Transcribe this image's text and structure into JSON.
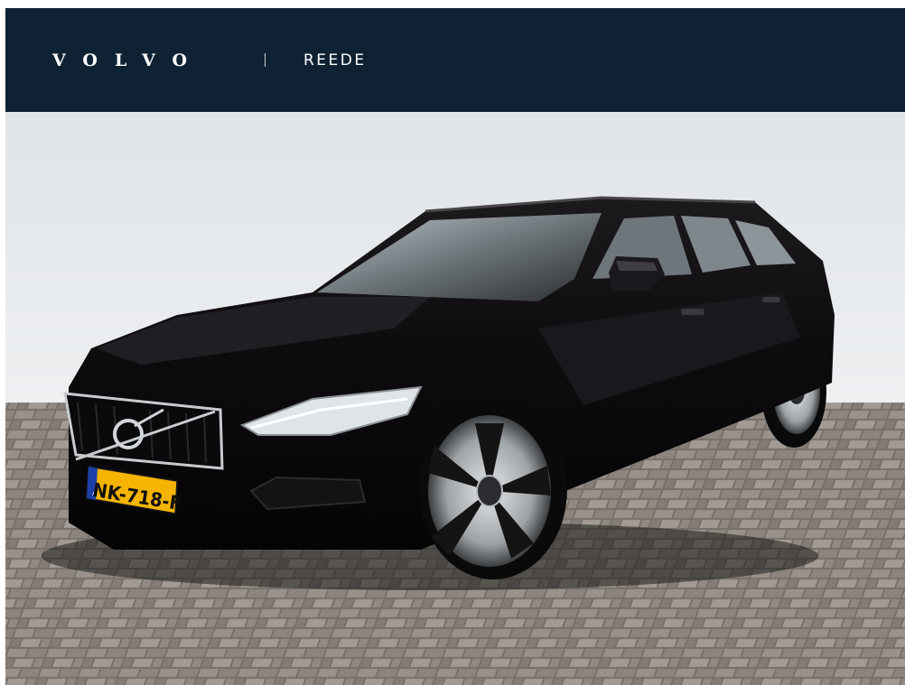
{
  "header": {
    "brand": "VOLVO",
    "separator": "|",
    "dealer": "REEDE",
    "background_color": "#0e2233"
  },
  "photo": {
    "license_plate": "NK-718-F",
    "plate_country": "NL",
    "grille_badge": "VOLVO",
    "car_color": "#0f0d10",
    "plate_color": "#f5b400"
  }
}
